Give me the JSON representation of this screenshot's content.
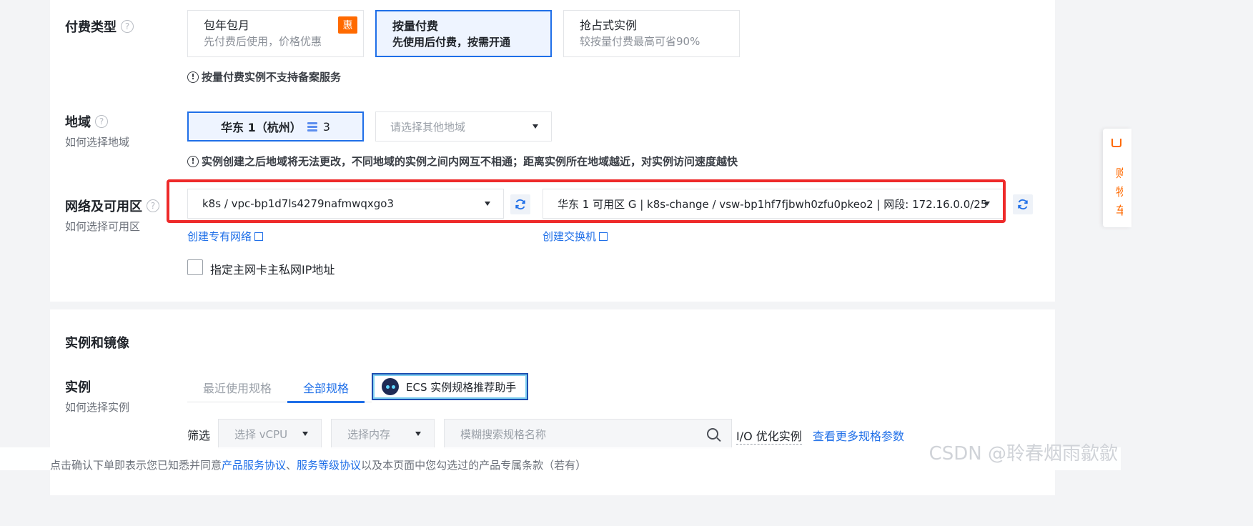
{
  "payment": {
    "label": "付费类型",
    "options": [
      {
        "title": "包年包月",
        "desc": "先付费后使用，价格优惠",
        "badge": "惠"
      },
      {
        "title": "按量付费",
        "desc": "先使用后付费，按需开通"
      },
      {
        "title": "抢占式实例",
        "desc": "较按量付费最高可省90%"
      }
    ],
    "selected": 1,
    "notice": "按量付费实例不支持备案服务"
  },
  "region": {
    "label": "地域",
    "sub": "如何选择地域",
    "selected_name": "华东 1（杭州）",
    "selected_count": "3",
    "other_placeholder": "请选择其他地域",
    "notice": "实例创建之后地域将无法更改，不同地域的实例之间内网互不相通；距离实例所在地域越近，对实例访问速度越快"
  },
  "network": {
    "label": "网络及可用区",
    "sub": "如何选择可用区",
    "vpc_value": "k8s / vpc-bp1d7ls4279nafmwqxgo3",
    "vswitch_value": "华东 1 可用区 G | k8s-change / vsw-bp1hf7fjbwh0zfu0pkeo2 | 网段: 172.16.0.0/25",
    "create_vpc_link": "创建专有网络",
    "create_vswitch_link": "创建交换机",
    "private_ip_checkbox": "指定主网卡主私网IP地址",
    "highlight_color": "#ee2a2a"
  },
  "instance_section": {
    "title": "实例和镜像",
    "label": "实例",
    "sub": "如何选择实例",
    "tabs": [
      "最近使用规格",
      "全部规格"
    ],
    "active_tab": 1,
    "assistant_button": "ECS 实例规格推荐助手",
    "filter_label": "筛选",
    "vcpu_placeholder": "选择 vCPU",
    "memory_placeholder": "选择内存",
    "search_placeholder": "模糊搜索规格名称",
    "io_label": "I/O 优化实例",
    "more_link": "查看更多规格参数"
  },
  "footer": {
    "prefix": "点击确认下单即表示您已知悉并同意",
    "link1": "产品服务协议",
    "sep": "、",
    "link2": "服务等级协议",
    "suffix": "以及本页面中您勾选过的产品专属条款（若有）"
  },
  "watermark": "CSDN @聆春烟雨歙歙",
  "cart_tab": "购物车",
  "colors": {
    "accent": "#1f6fe8",
    "brand_orange": "#ff6a00"
  }
}
